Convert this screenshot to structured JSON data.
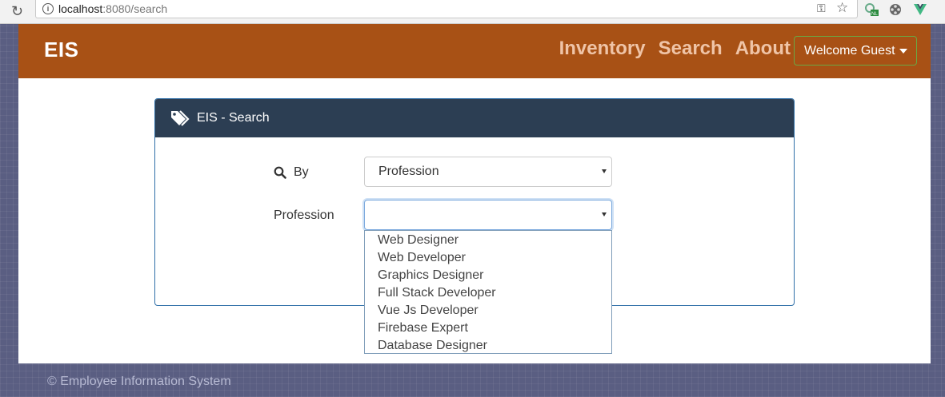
{
  "browser": {
    "url_host": "localhost",
    "url_rest": ":8080/search"
  },
  "navbar": {
    "brand": "EIS",
    "links": [
      "Inventory",
      "Search",
      "About"
    ],
    "user_menu": "Welcome Guest"
  },
  "card": {
    "title": "EIS - Search",
    "by_label": "By",
    "by_value": "Profession",
    "profession_label": "Profession",
    "profession_value": ""
  },
  "dropdown": {
    "options": [
      "Web Designer",
      "Web Developer",
      "Graphics Designer",
      "Full Stack Developer",
      "Vue Js Developer",
      "Firebase Expert",
      "Database Designer"
    ]
  },
  "footer": {
    "text": "© Employee Information System"
  },
  "colors": {
    "navbar": "#a85115",
    "card_header": "#2c3e53",
    "background": "#5a5e82"
  }
}
